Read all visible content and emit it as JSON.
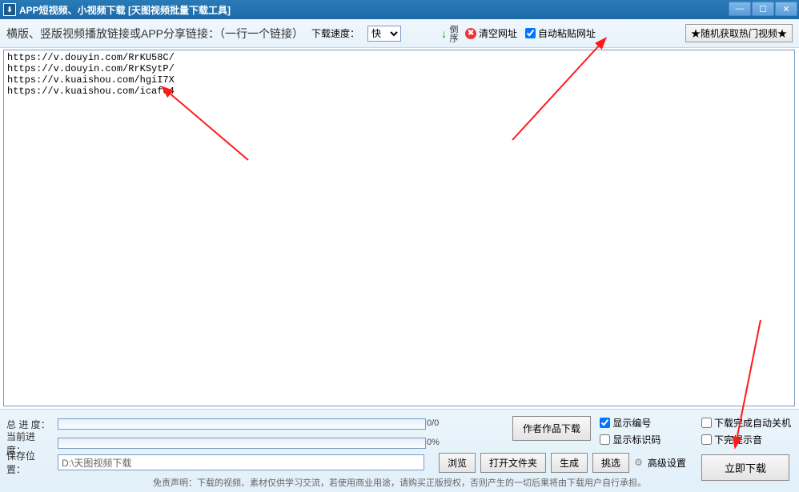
{
  "title": "APP短视频、小视频下载 [天图视频批量下载工具]",
  "toolbar": {
    "mainLabel": "横版、竖版视频播放链接或APP分享链接：（一行一个链接）",
    "speedLabel": "下载速度：",
    "speedValue": "快",
    "sortLabel": "倒序",
    "clearLabel": "清空网址",
    "autoPasteLabel": "自动粘贴网址",
    "randomBtn": "★随机获取热门视频★"
  },
  "urls": "https://v.douyin.com/RrKU58C/\nhttps://v.douyin.com/RrKSytP/\nhttps://v.kuaishou.com/hgiI7X\nhttps://v.kuaishou.com/icafe4\n",
  "bottom": {
    "totalLabel": "总 进 度：",
    "totalProg": "0/0",
    "currentLabel": "当前进度：",
    "currentProg": "0%",
    "pathLabel": "保存位置：",
    "pathValue": "D:\\天图视频下载",
    "browseBtn": "浏览",
    "openFolderBtn": "打开文件夹",
    "generateBtn": "生成",
    "pickBtn": "挑选",
    "advBtn": "高级设置",
    "authorBtn": "作者作品下载",
    "showNumLabel": "显示编号",
    "showCodeLabel": "显示标识码",
    "autoShutdown": "下载完成自动关机",
    "soundLabel": "下完提示音",
    "downloadBtn": "立即下载",
    "disclaimer": "免责声明：下载的视频、素材仅供学习交流，若使用商业用途，请购买正版授权，否则产生的一切后果将由下载用户自行承担。"
  }
}
